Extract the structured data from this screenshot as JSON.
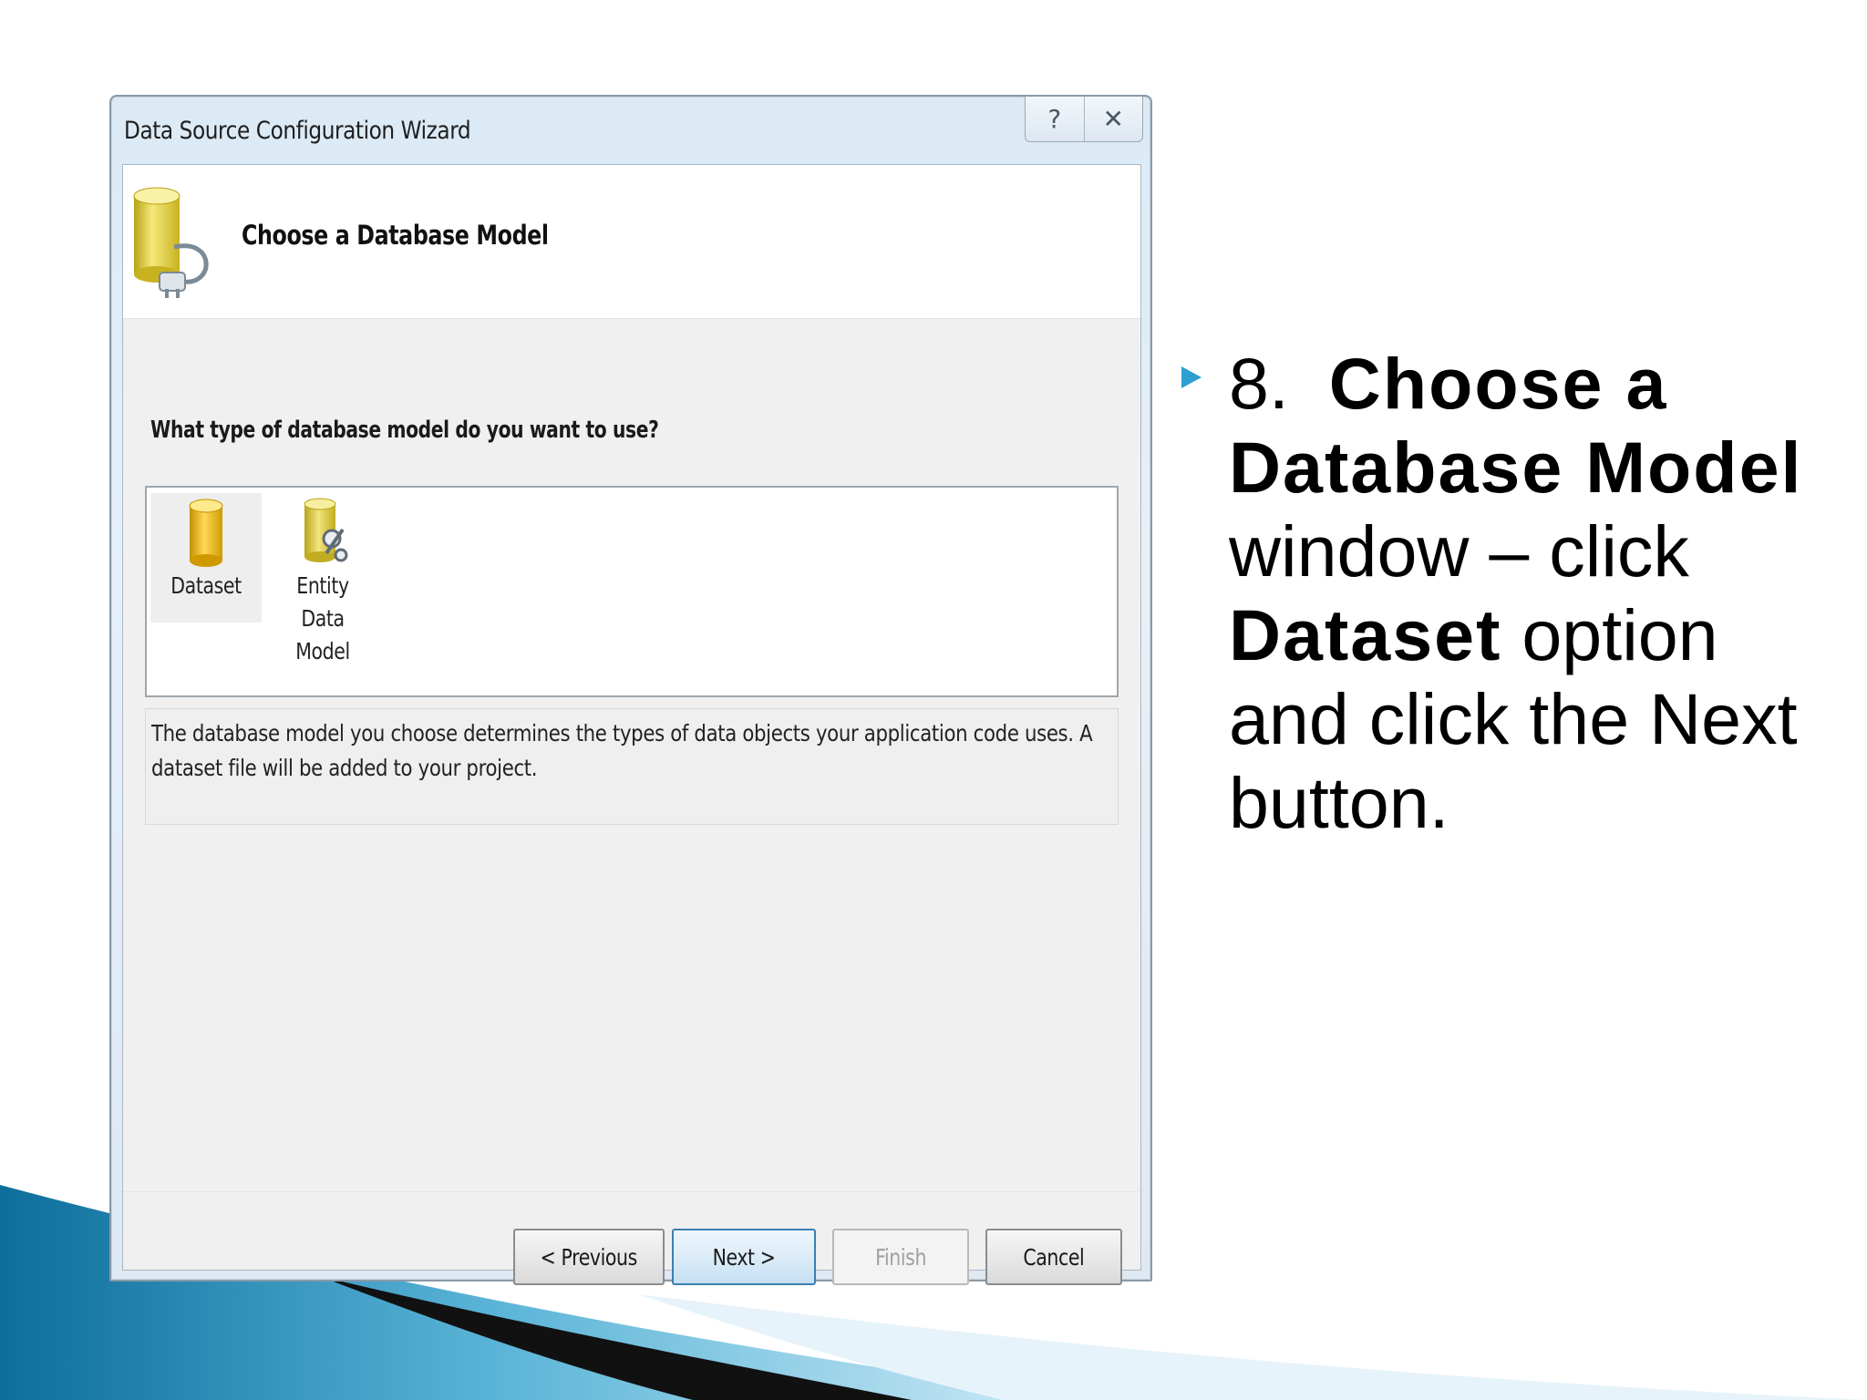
{
  "dialog": {
    "title": "Data Source Configuration Wizard",
    "help_button": "?",
    "close_button": "✕",
    "header_title": "Choose a Database Model",
    "question": "What type of database model do you want to use?",
    "models": [
      {
        "label": "Dataset",
        "selected": true
      },
      {
        "label": "Entity Data Model",
        "selected": false
      }
    ],
    "description": "The database model you choose determines the types of data objects your application code uses. A dataset file will be added to your project.",
    "buttons": {
      "previous": "< Previous",
      "next": "Next >",
      "finish": "Finish",
      "cancel": "Cancel"
    }
  },
  "slide": {
    "step_number": "8.",
    "bold_1": "Choose a Database Model",
    "plain_1": " window – click ",
    "bold_2": "Dataset",
    "plain_2": " option and click the Next button."
  },
  "colors": {
    "bullet": "#2f9fd0",
    "swoosh_blue": "#1f86b8",
    "default_button_border": "#3c7fb1"
  }
}
